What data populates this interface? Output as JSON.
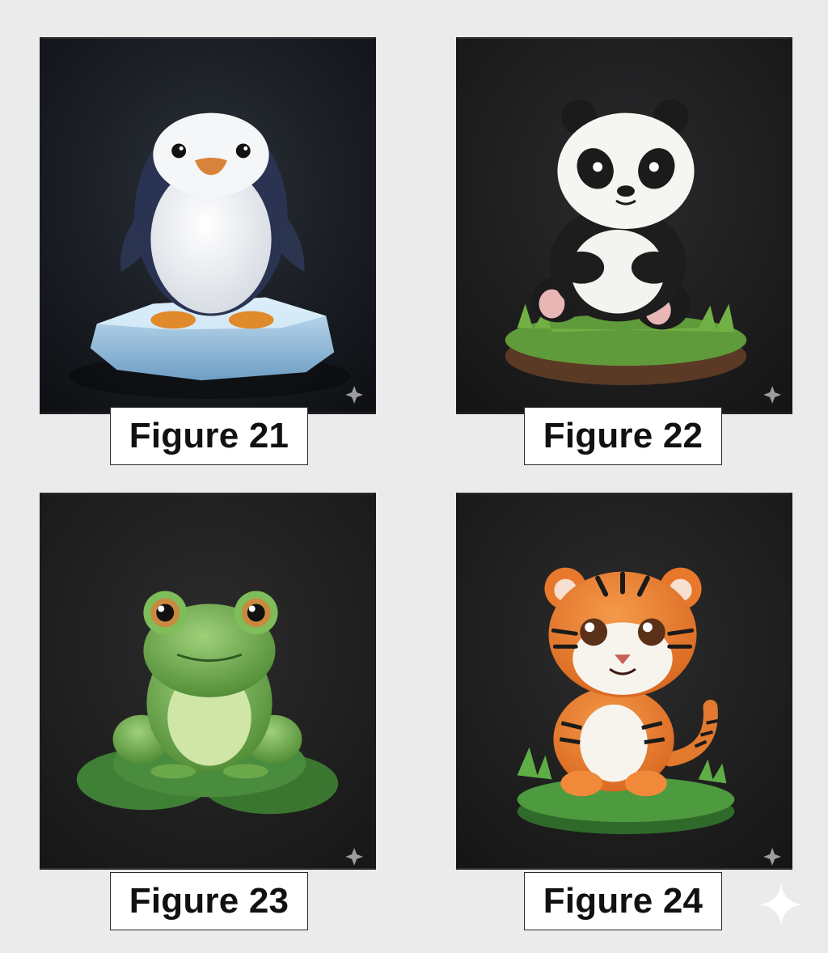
{
  "figures": [
    {
      "caption": "Figure 21",
      "subject": "penguin-figurine-on-ice"
    },
    {
      "caption": "Figure 22",
      "subject": "panda-figurine-on-grass"
    },
    {
      "caption": "Figure 23",
      "subject": "frog-figurine-on-lily-pad"
    },
    {
      "caption": "Figure 24",
      "subject": "tiger-cub-figurine-on-grass"
    }
  ],
  "colors": {
    "page_background": "#ebebeb",
    "tile_background": "#1c1e22",
    "caption_background": "#ffffff",
    "caption_text": "#111111"
  }
}
